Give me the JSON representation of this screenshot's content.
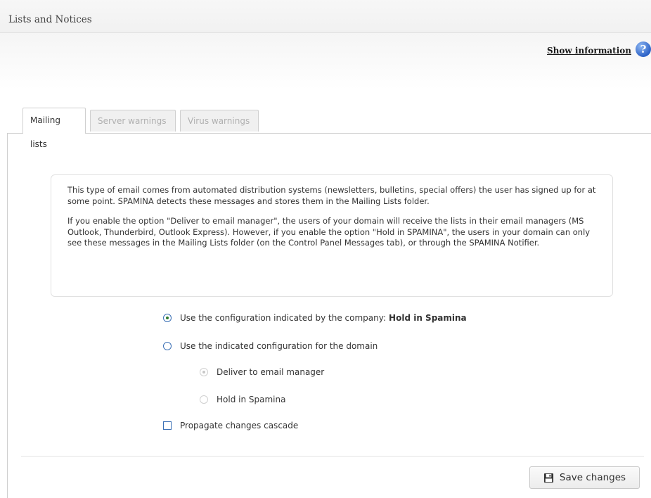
{
  "header": {
    "title": "Lists and Notices"
  },
  "info": {
    "show_information": "Show information",
    "help_glyph": "?"
  },
  "tabs": [
    {
      "label": "Mailing lists",
      "state": "active"
    },
    {
      "label": "Server warnings",
      "state": "disabled"
    },
    {
      "label": "Virus warnings",
      "state": "disabled"
    }
  ],
  "description": {
    "paragraph1": "This type of email comes from automated distribution systems (newsletters, bulletins, special offers) the user has signed up for at some point. SPAMINA detects these messages and stores them in the Mailing Lists folder.",
    "paragraph2": "If you enable the option \"Deliver to email manager\", the users of your domain will receive the lists in their email managers (MS Outlook, Thunderbird, Outlook Express). However, if you enable the option \"Hold in SPAMINA\", the users in your domain can only see these messages in the Mailing Lists folder (on the Control Panel Messages tab), or through the SPAMINA Notifier."
  },
  "options": {
    "company_config_label": "Use the configuration indicated by the company:",
    "company_config_value": "Hold in Spamina",
    "company_config_selected": true,
    "domain_config_label": "Use the indicated configuration for the domain",
    "domain_config_selected": false,
    "sub_options": [
      {
        "label": "Deliver to email manager",
        "selected": true,
        "enabled": false
      },
      {
        "label": "Hold in Spamina",
        "selected": false,
        "enabled": false
      }
    ],
    "propagate_label": "Propagate changes cascade",
    "propagate_checked": false
  },
  "actions": {
    "save_label": "Save changes",
    "save_icon": "floppy-disk-icon"
  },
  "colors": {
    "accent": "#3a6fb5",
    "selected_dot": "#2d7a2d",
    "help_icon": "#2e63c7"
  }
}
